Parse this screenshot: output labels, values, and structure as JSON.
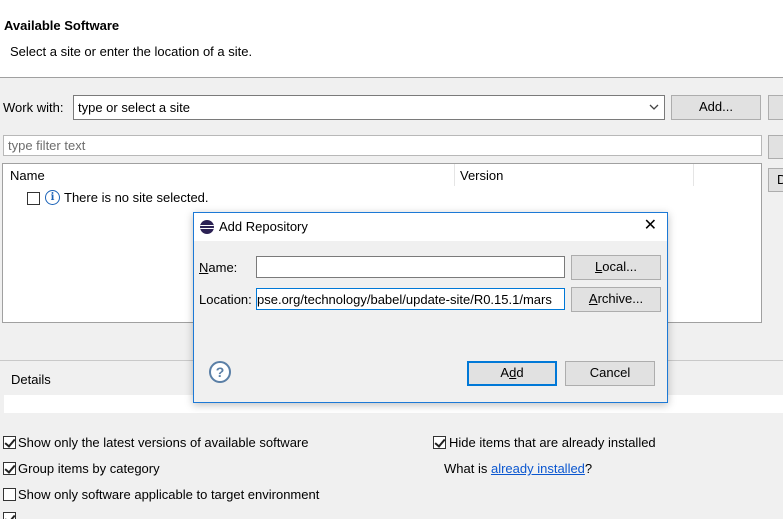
{
  "header": {
    "title": "Available Software",
    "subtitle": "Select a site or enter the location of a site."
  },
  "work_with": {
    "label": "Work with:",
    "value": "type or select a site",
    "add_button": "Add..."
  },
  "filter": {
    "placeholder": "type filter text"
  },
  "table": {
    "columns": [
      "Name",
      "Version"
    ],
    "rows": [
      {
        "text": "There is no site selected.",
        "checked": false
      }
    ]
  },
  "details": {
    "label": "Details"
  },
  "options": {
    "show_latest": {
      "label": "Show only the latest versions of available software",
      "checked": true
    },
    "hide_installed": {
      "label": "Hide items that are already installed",
      "checked": true
    },
    "group_by_category": {
      "label": "Group items by category",
      "checked": true
    },
    "what_is_prefix": "What is ",
    "already_installed_link": "already installed",
    "what_is_suffix": "?",
    "show_applicable": {
      "label": "Show only software applicable to target environment",
      "checked": false
    }
  },
  "dialog": {
    "title": "Add Repository",
    "close_glyph": "✕",
    "name_label_mnemonic": "N",
    "name_label_rest": "ame:",
    "name_value": "",
    "local_button_pre": "",
    "local_button_mnemonic": "L",
    "local_button_rest": "ocal...",
    "location_label": "Location:",
    "location_value": "pse.org/technology/babel/update-site/R0.15.1/mars",
    "archive_button_mnemonic": "A",
    "archive_button_rest": "rchive...",
    "add_button_pre": "A",
    "add_button_mnemonic": "d",
    "add_button_rest": "d",
    "cancel_button": "Cancel",
    "help_glyph": "?"
  },
  "icons": {
    "info": "info-icon",
    "help": "help-icon",
    "app": "eclipse-icon",
    "dropdown": "chevron-down-icon",
    "close": "close-icon"
  },
  "colors": {
    "accent": "#0078d7",
    "link": "#0b57d0",
    "dialog_border": "#1c79d6"
  }
}
